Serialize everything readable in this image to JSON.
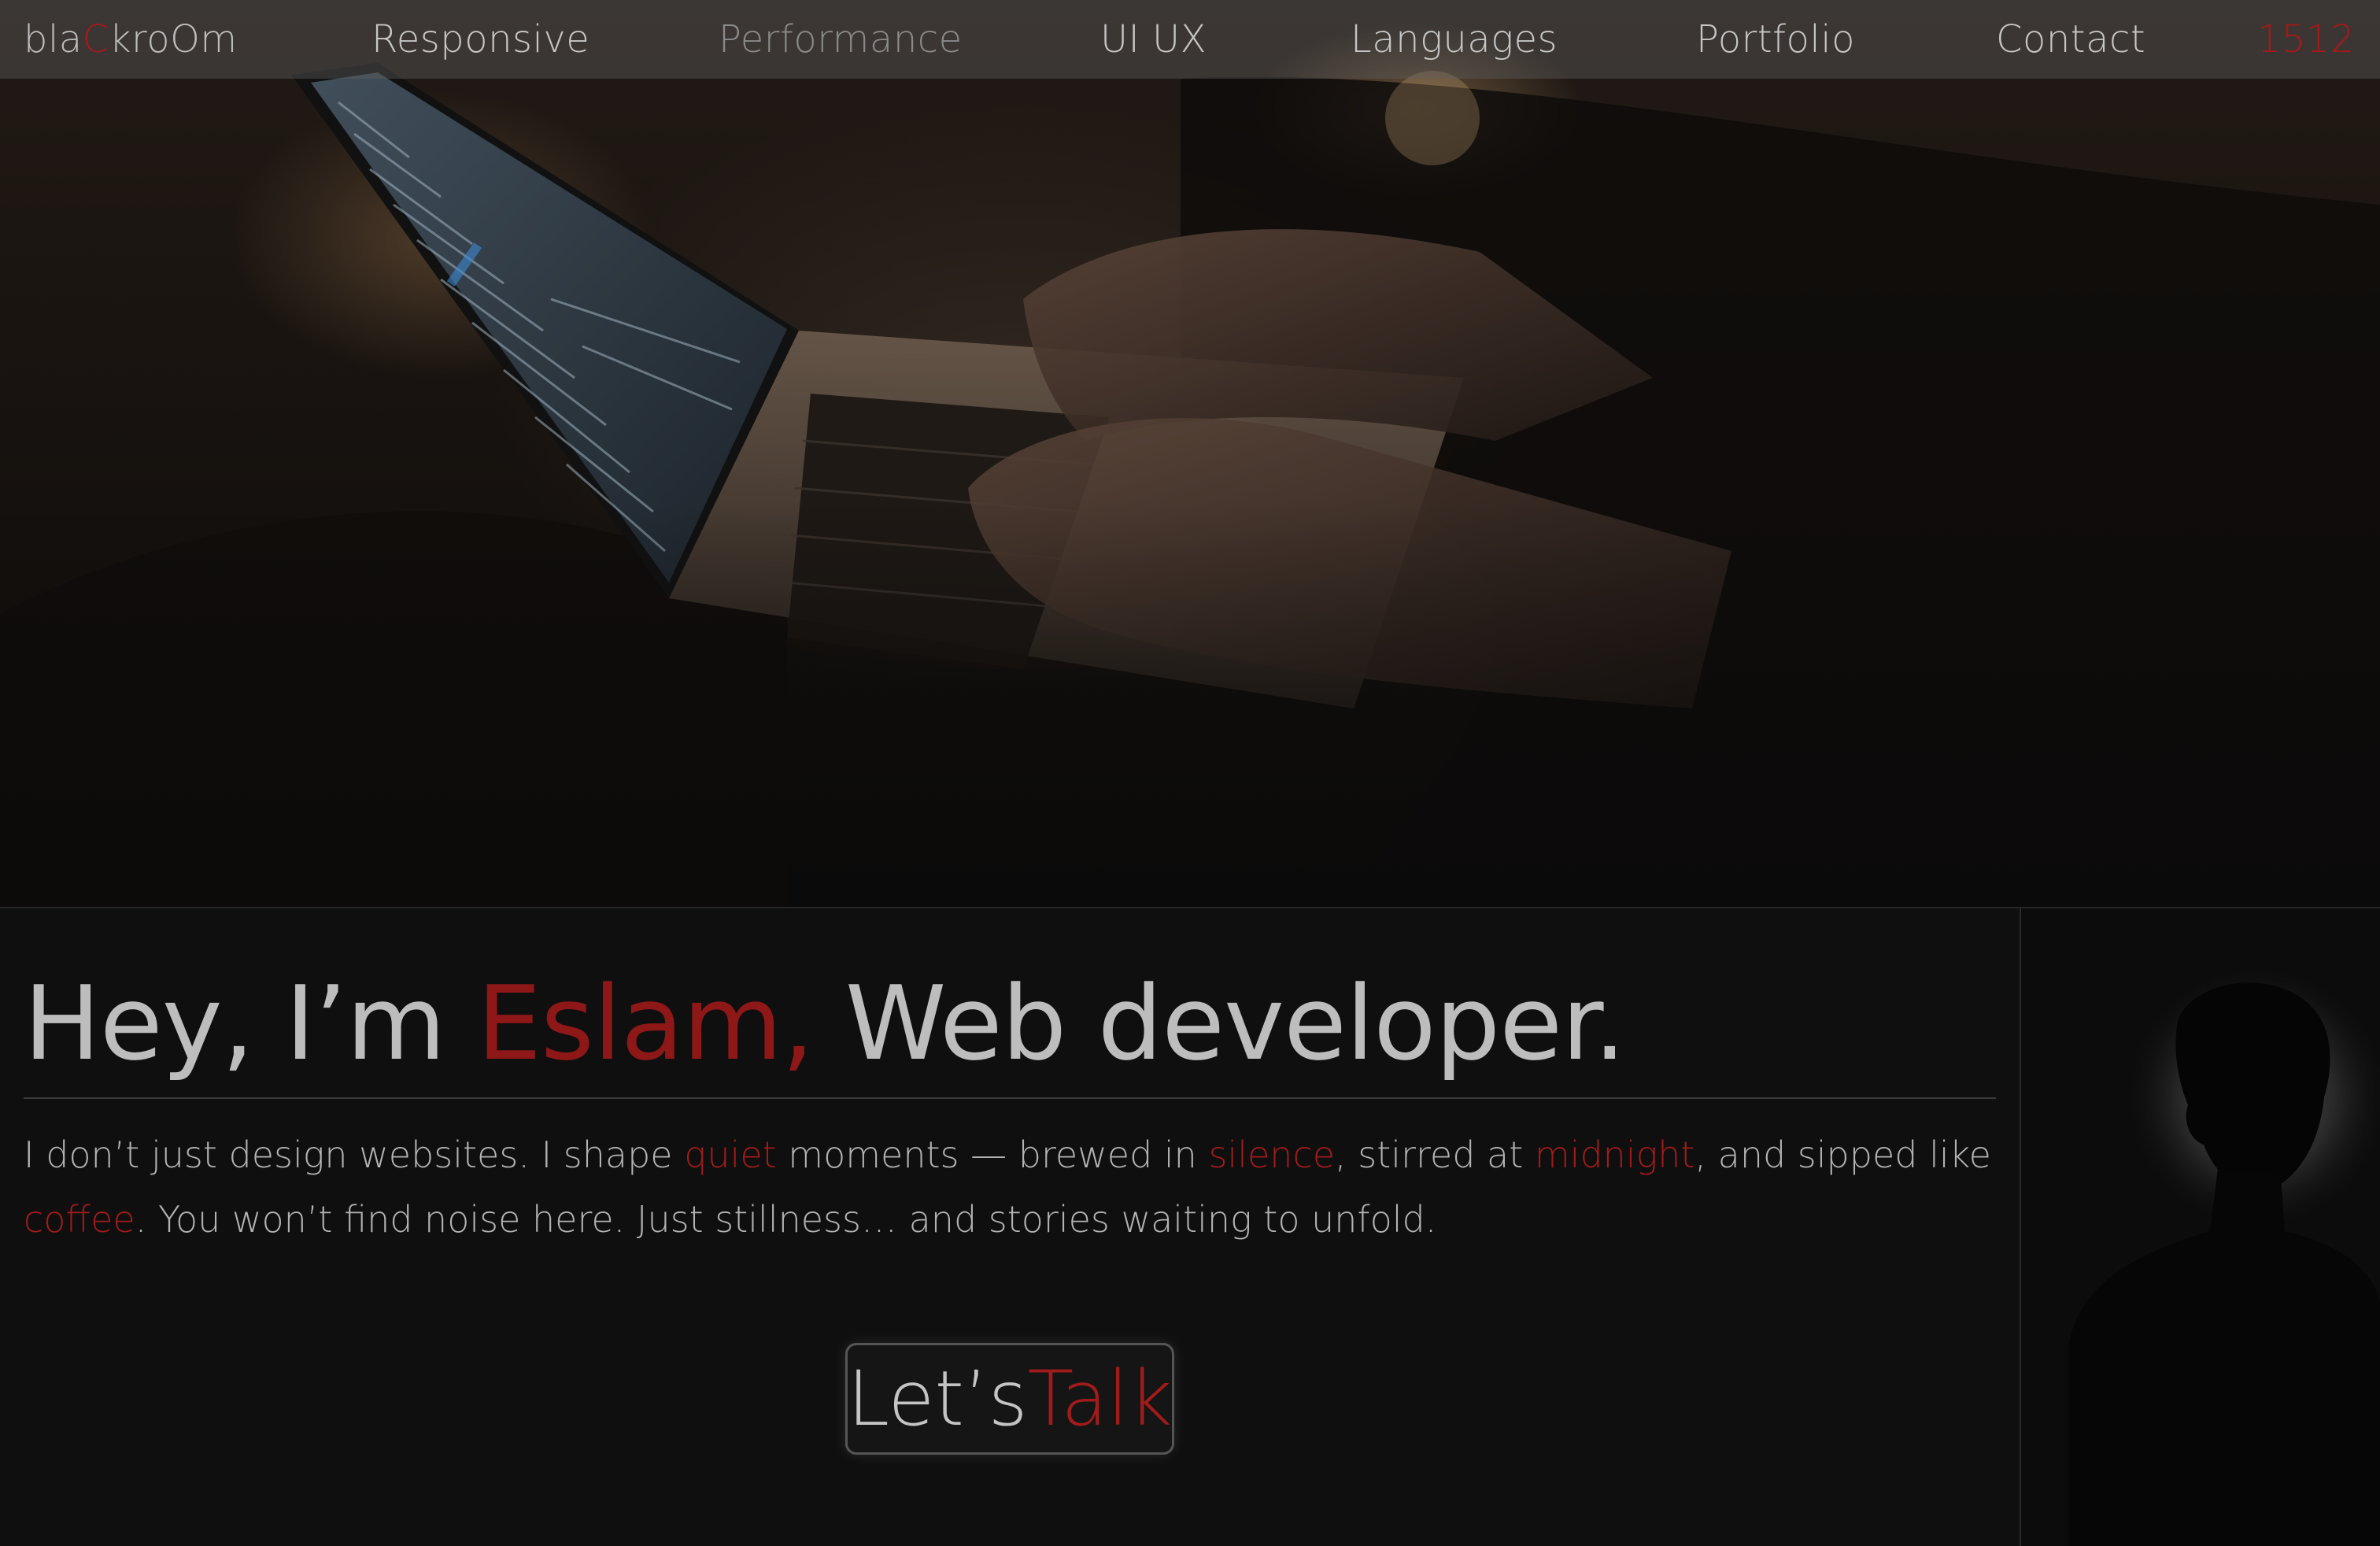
{
  "nav": {
    "logo": {
      "pre": "bla",
      "accent": "C",
      "post": "kroOm"
    },
    "items": [
      {
        "label": "Responsive"
      },
      {
        "label": "Performance"
      },
      {
        "label": "UI UX"
      },
      {
        "label": "Languages"
      },
      {
        "label": "Portfolio"
      },
      {
        "label": "Contact"
      }
    ],
    "counter": "1512"
  },
  "hero": {
    "greeting": "Hey, I’m ",
    "name": "Eslam,",
    "role": " Web developer.",
    "intro": {
      "p1": "I don’t just design websites. I shape ",
      "w1": "quiet",
      "p2": " moments — brewed in ",
      "w2": "silence",
      "p3": ", stirred at ",
      "w3": "midnight",
      "p4": ", and sipped like ",
      "w4": "coffee",
      "p5": ". You won’t find noise here. Just stillness… and stories waiting to unfold."
    },
    "cta": {
      "pre": "Let’s ",
      "accent": "Talk"
    }
  },
  "colors": {
    "accent": "#a11b1b",
    "background": "#0f0f0f",
    "text": "#bdbdbd"
  }
}
